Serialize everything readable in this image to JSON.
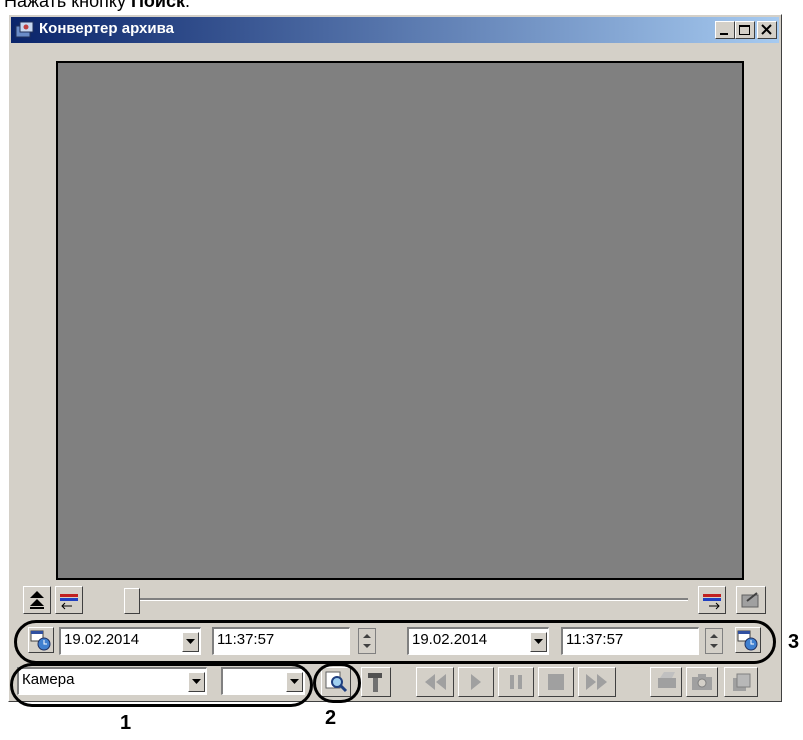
{
  "doc_caption": {
    "prefix": "Нажать кнопку ",
    "bold": "Поиск",
    "suffix": "."
  },
  "window": {
    "title": "Конвертер архива"
  },
  "range_start": {
    "date": "19.02.2014",
    "time": "11:37:57"
  },
  "range_end": {
    "date": "19.02.2014",
    "time": "11:37:57"
  },
  "camera_select": {
    "value": "Камера"
  },
  "second_select": {
    "value": ""
  },
  "annotations": {
    "one": "1",
    "two": "2",
    "three": "3"
  },
  "icons": [
    "app-icon",
    "minimize-icon",
    "maximize-icon",
    "close-icon",
    "collapse-up-icon",
    "mark-start-icon",
    "mark-end-icon",
    "export-icon",
    "datetime-from-icon",
    "datetime-to-icon",
    "search-icon",
    "tools-icon",
    "rewind-icon",
    "play-icon",
    "pause-icon",
    "stop-icon",
    "fast-forward-icon",
    "print-icon",
    "snapshot-icon",
    "copy-icon"
  ]
}
